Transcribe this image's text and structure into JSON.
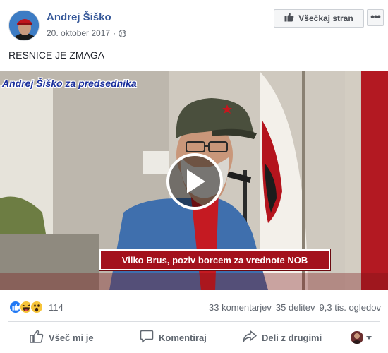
{
  "post": {
    "author": "Andrej Šiško",
    "date": "20. oktober 2017",
    "privacy_icon": "globe-icon",
    "like_page_label": "Všečkaj stran",
    "more_label": "•••",
    "text": "RESNICE JE ZMAGA"
  },
  "video": {
    "title_overlay": "Andrej Šiško za predsednika",
    "caption": "Vilko Brus, poziv borcem za vrednote NOB",
    "play_icon": "play-icon"
  },
  "stats": {
    "reaction_icons": [
      "like-icon",
      "haha-icon",
      "wow-icon"
    ],
    "reaction_count": "114",
    "comments": "33 komentarjev",
    "shares": "35 delitev",
    "views": "9,3 tis. ogledov"
  },
  "actions": {
    "like": "Všeč mi je",
    "comment": "Komentiraj",
    "share": "Deli z drugimi"
  },
  "colors": {
    "link_blue": "#365899",
    "caption_red": "#a3111c",
    "title_blue": "#1a2f9c"
  }
}
